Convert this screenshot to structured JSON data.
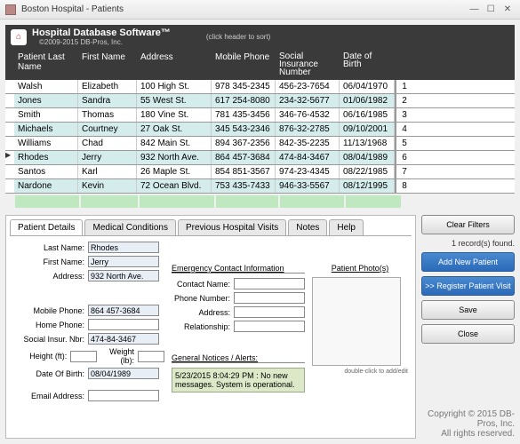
{
  "window": {
    "title": "Boston Hospital - Patients"
  },
  "header": {
    "title": "Hospital Database Software™",
    "copy": "©2009-2015 DB-Pros, Inc.",
    "sortHint": "(click header to sort)"
  },
  "columns": {
    "last": "Patient Last Name",
    "first": "First Name",
    "addr": "Address",
    "phone": "Mobile Phone",
    "ssn": "Social Insurance Number",
    "dob": "Date of Birth"
  },
  "rows": [
    {
      "last": "Walsh",
      "first": "Elizabeth",
      "addr": "100 High St.",
      "phone": "978 345-2345",
      "ssn": "456-23-7654",
      "dob": "06/04/1970",
      "idx": "1"
    },
    {
      "last": "Jones",
      "first": "Sandra",
      "addr": "55 West St.",
      "phone": "617 254-8080",
      "ssn": "234-32-5677",
      "dob": "01/06/1982",
      "idx": "2"
    },
    {
      "last": "Smith",
      "first": "Thomas",
      "addr": "180 Vine St.",
      "phone": "781 435-3456",
      "ssn": "346-76-4532",
      "dob": "06/16/1985",
      "idx": "3"
    },
    {
      "last": "Michaels",
      "first": "Courtney",
      "addr": "27 Oak St.",
      "phone": "345 543-2346",
      "ssn": "876-32-2785",
      "dob": "09/10/2001",
      "idx": "4"
    },
    {
      "last": "Williams",
      "first": "Chad",
      "addr": "842 Main St.",
      "phone": "894 367-2356",
      "ssn": "842-35-2235",
      "dob": "11/13/1968",
      "idx": "5"
    },
    {
      "last": "Rhodes",
      "first": "Jerry",
      "addr": "932 North Ave.",
      "phone": "864 457-3684",
      "ssn": "474-84-3467",
      "dob": "08/04/1989",
      "idx": "6",
      "selected": true
    },
    {
      "last": "Santos",
      "first": "Karl",
      "addr": "26 Maple St.",
      "phone": "854 851-3567",
      "ssn": "974-23-4345",
      "dob": "08/22/1985",
      "idx": "7"
    },
    {
      "last": "Nardone",
      "first": "Kevin",
      "addr": "72 Ocean Blvd.",
      "phone": "753 435-7433",
      "ssn": "946-33-5567",
      "dob": "08/12/1995",
      "idx": "8"
    }
  ],
  "tabs": [
    "Patient Details",
    "Medical Conditions",
    "Previous Hospital Visits",
    "Notes",
    "Help"
  ],
  "detail": {
    "labels": {
      "last": "Last Name:",
      "first": "First Name:",
      "addr": "Address:",
      "mobile": "Mobile Phone:",
      "home": "Home Phone:",
      "ssn": "Social Insur. Nbr:",
      "height": "Height (ft):",
      "weight": "Weight (lb):",
      "dob": "Date Of Birth:",
      "email": "Email Address:",
      "eci": "Emergency Contact Information",
      "contact": "Contact Name:",
      "pnum": "Phone Number:",
      "eaddr": "Address:",
      "rel": "Relationship:",
      "notices": "General Notices / Alerts:",
      "photo": "Patient Photo(s)",
      "photohint": "double-click to add/edit"
    },
    "values": {
      "last": "Rhodes",
      "first": "Jerry",
      "addr": "932 North Ave.",
      "mobile": "864 457-3684",
      "home": "",
      "ssn": "474-84-3467",
      "height": "",
      "weight": "",
      "dob": "08/04/1989",
      "email": "",
      "contact": "",
      "pnum": "",
      "eaddr": "",
      "rel": "",
      "noticeText": "5/23/2015 8:04:29 PM : No new messages. System is operational."
    }
  },
  "sidebar": {
    "clear": "Clear Filters",
    "found": "1 record(s) found.",
    "add": "Add New Patient",
    "register": ">> Register Patient Visit",
    "save": "Save",
    "close": "Close"
  },
  "footer": {
    "l1": "Copyright © 2015 DB-Pros, Inc.",
    "l2": "All rights reserved."
  }
}
